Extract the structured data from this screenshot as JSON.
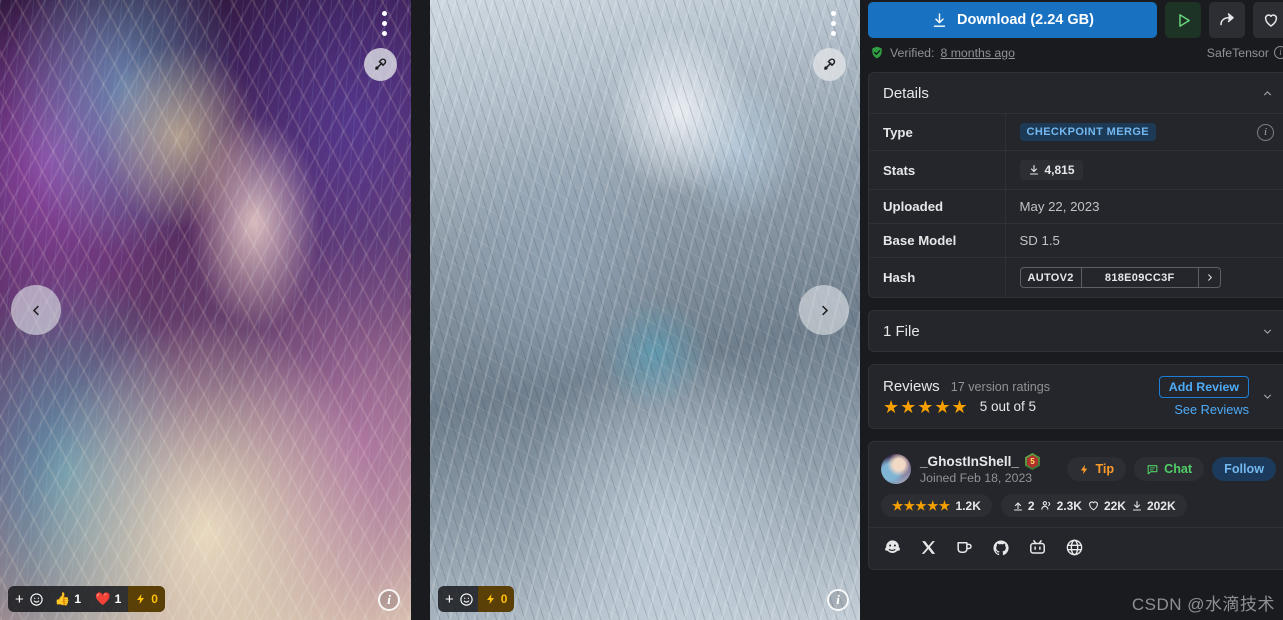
{
  "gallery": {
    "images": [
      {
        "alt": "fantasy-portrait-artwork",
        "menu_icon": "more-vertical-icon",
        "remix_icon": "remix-chain-icon",
        "info_icon": "info-icon",
        "reactions": [
          {
            "icon": "plus-icon",
            "emoji": "smiley-icon",
            "count": ""
          },
          {
            "icon": "thumbs-up-icon",
            "count": "1"
          },
          {
            "icon": "heart-icon",
            "count": "1"
          },
          {
            "icon": "lightning-icon",
            "count": "0"
          }
        ]
      },
      {
        "alt": "cyborg-portrait-artwork",
        "menu_icon": "more-vertical-icon",
        "remix_icon": "remix-chain-icon",
        "info_icon": "info-icon",
        "reactions": [
          {
            "icon": "plus-icon",
            "emoji": "smiley-icon",
            "count": ""
          },
          {
            "icon": "lightning-icon",
            "count": "0"
          }
        ]
      }
    ],
    "prev_label": "chevron-left-icon",
    "next_label": "chevron-right-icon"
  },
  "actions": {
    "download_label": "Download (2.24 GB)",
    "download_icon": "download-icon",
    "run_icon": "play-icon",
    "share_icon": "share-icon",
    "favorite_icon": "heart-outline-icon",
    "accent_blue": "#1971c2",
    "accent_green": "#51cf66"
  },
  "verification": {
    "shield_icon": "shield-check-icon",
    "prefix": "Verified:",
    "time": "8 months ago",
    "format_label": "SafeTensor",
    "format_info_icon": "info-icon"
  },
  "details": {
    "title": "Details",
    "collapse_icon": "chevron-up-icon",
    "rows": [
      {
        "label": "Type",
        "value": "CHECKPOINT MERGE",
        "kind": "badge",
        "trailing_icon": "info-icon"
      },
      {
        "label": "Stats",
        "value": "4,815",
        "kind": "stat",
        "icon": "download-icon"
      },
      {
        "label": "Uploaded",
        "value": "May 22, 2023",
        "kind": "text"
      },
      {
        "label": "Base Model",
        "value": "SD 1.5",
        "kind": "text"
      },
      {
        "label": "Hash",
        "kind": "hash",
        "algo": "AUTOV2",
        "hash": "818E09CC3F",
        "expand_icon": "chevron-right-icon"
      }
    ]
  },
  "files": {
    "title": "1 File",
    "expand_icon": "chevron-down-icon"
  },
  "reviews": {
    "title": "Reviews",
    "version_ratings": "17 version ratings",
    "stars": "★★★★★",
    "score_label": "5 out of 5",
    "add_review_label": "Add Review",
    "see_reviews_label": "See Reviews",
    "expand_icon": "chevron-down-icon",
    "star_color": "#f59f00"
  },
  "creator": {
    "avatar": "user-avatar",
    "username": "_GhostInShell_",
    "level_badge": "5",
    "joined": "Joined Feb 18, 2023",
    "buttons": [
      {
        "label": "Tip",
        "icon": "lightning-icon",
        "style": "tip"
      },
      {
        "label": "Chat",
        "icon": "chat-bubble-icon",
        "style": "chat"
      },
      {
        "label": "Follow",
        "icon": "",
        "style": "follow"
      }
    ],
    "stats": {
      "rating_stars": "★★★★★",
      "rating_count": "1.2K",
      "uploads_icon": "upload-icon",
      "uploads": "2",
      "followers_icon": "users-icon",
      "followers": "2.3K",
      "likes_icon": "heart-outline-icon",
      "likes": "22K",
      "downloads_icon": "download-icon",
      "downloads": "202K"
    },
    "socials": [
      "huggingface-icon",
      "x-twitter-icon",
      "kofi-cup-icon",
      "github-icon",
      "bilibili-icon",
      "website-globe-icon"
    ]
  },
  "watermark": "CSDN @水滴技术"
}
